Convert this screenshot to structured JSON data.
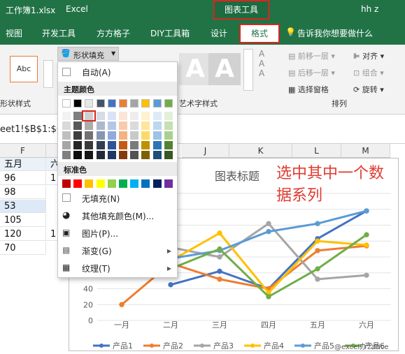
{
  "title_bar": {
    "filename": "工作簿1.xlsx",
    "app": "Excel",
    "chart_tools": "图表工具",
    "user": "hh z"
  },
  "ribbon_tabs": [
    "视图",
    "开发工具",
    "方方格子",
    "DIY工具箱",
    "设计",
    "格式"
  ],
  "tell_me": "告诉我你想要做什么",
  "ribbon": {
    "shape_style_preview": "Abc",
    "shape_fill_label": "形状填充",
    "shape_styles_group": "形状样式",
    "art_text_group": "艺术字样式",
    "arrange_group": "排列",
    "bring_forward": "前移一层",
    "send_backward": "后移一层",
    "selection_pane": "选择窗格",
    "align": "对齐",
    "group": "组合",
    "rotate": "旋转"
  },
  "formula_bar": {
    "reference": "eet1!$B$1:$G"
  },
  "columns": [
    "F",
    "J",
    "K",
    "L",
    "M"
  ],
  "sheet": {
    "col_f_header": "五月",
    "col_f_values": [
      "96",
      "98",
      "53",
      "105",
      "120",
      "70"
    ],
    "col_g_partial": [
      "六",
      "1",
      "1"
    ]
  },
  "dropdown": {
    "auto": "自动(A)",
    "theme_colors_label": "主题颜色",
    "standard_colors_label": "标准色",
    "no_fill": "无填充(N)",
    "more_colors": "其他填充颜色(M)...",
    "picture": "图片(P)...",
    "gradient": "渐变(G)",
    "texture": "纹理(T)",
    "theme_top": [
      "#ffffff",
      "#000000",
      "#e7e6e6",
      "#44546a",
      "#4472c4",
      "#ed7d31",
      "#a5a5a5",
      "#ffc000",
      "#5b9bd5",
      "#70ad47"
    ],
    "theme_shades": [
      [
        "#f2f2f2",
        "#d9d9d9",
        "#bfbfbf",
        "#a6a6a6",
        "#808080"
      ],
      [
        "#7f7f7f",
        "#595959",
        "#3f3f3f",
        "#262626",
        "#0d0d0d"
      ],
      [
        "#d0cece",
        "#aeabab",
        "#757171",
        "#3a3838",
        "#171616"
      ],
      [
        "#d6dce4",
        "#adb9ca",
        "#8496b0",
        "#333f4f",
        "#222a35"
      ],
      [
        "#dae3f3",
        "#b4c7e7",
        "#8faadc",
        "#2f5597",
        "#203864"
      ],
      [
        "#fbe5d6",
        "#f8cbad",
        "#f4b183",
        "#c55a11",
        "#843c0c"
      ],
      [
        "#ededed",
        "#dbdbdb",
        "#c9c9c9",
        "#7b7b7b",
        "#525252"
      ],
      [
        "#fff2cc",
        "#ffe699",
        "#ffd966",
        "#bf9000",
        "#7f6000"
      ],
      [
        "#deebf7",
        "#bdd7ee",
        "#9dc3e6",
        "#2e75b6",
        "#1f4e79"
      ],
      [
        "#e2f0d9",
        "#c5e0b4",
        "#a9d18e",
        "#548235",
        "#385723"
      ]
    ],
    "standard": [
      "#c00000",
      "#ff0000",
      "#ffc000",
      "#ffff00",
      "#92d050",
      "#00b050",
      "#00b0f0",
      "#0070c0",
      "#002060",
      "#7030a0"
    ]
  },
  "annotation": {
    "line1": "选中其中一个数",
    "line2": "据系列"
  },
  "watermark": "@excel办公ffice",
  "chart_data": {
    "type": "line",
    "title": "图表标题",
    "categories": [
      "一月",
      "二月",
      "三月",
      "四月",
      "五月",
      "六月"
    ],
    "y_ticks": [
      "0",
      "20",
      "40",
      "60"
    ],
    "ylim": [
      0,
      160
    ],
    "series": [
      {
        "name": "产品1",
        "color": "#4472c4",
        "values": [
          null,
          45,
          62,
          40,
          103,
          138
        ]
      },
      {
        "name": "产品2",
        "color": "#ed7d31",
        "values": [
          20,
          72,
          52,
          40,
          88,
          94
        ]
      },
      {
        "name": "产品3",
        "color": "#a5a5a5",
        "values": [
          null,
          92,
          80,
          122,
          52,
          57
        ]
      },
      {
        "name": "产品4",
        "color": "#ffc000",
        "values": [
          null,
          75,
          110,
          35,
          100,
          95
        ]
      },
      {
        "name": "产品5",
        "color": "#5b9bd5",
        "values": [
          null,
          78,
          88,
          112,
          122,
          138
        ]
      },
      {
        "name": "产品6",
        "color": "#70ad47",
        "values": [
          null,
          65,
          90,
          30,
          65,
          108
        ]
      }
    ]
  }
}
